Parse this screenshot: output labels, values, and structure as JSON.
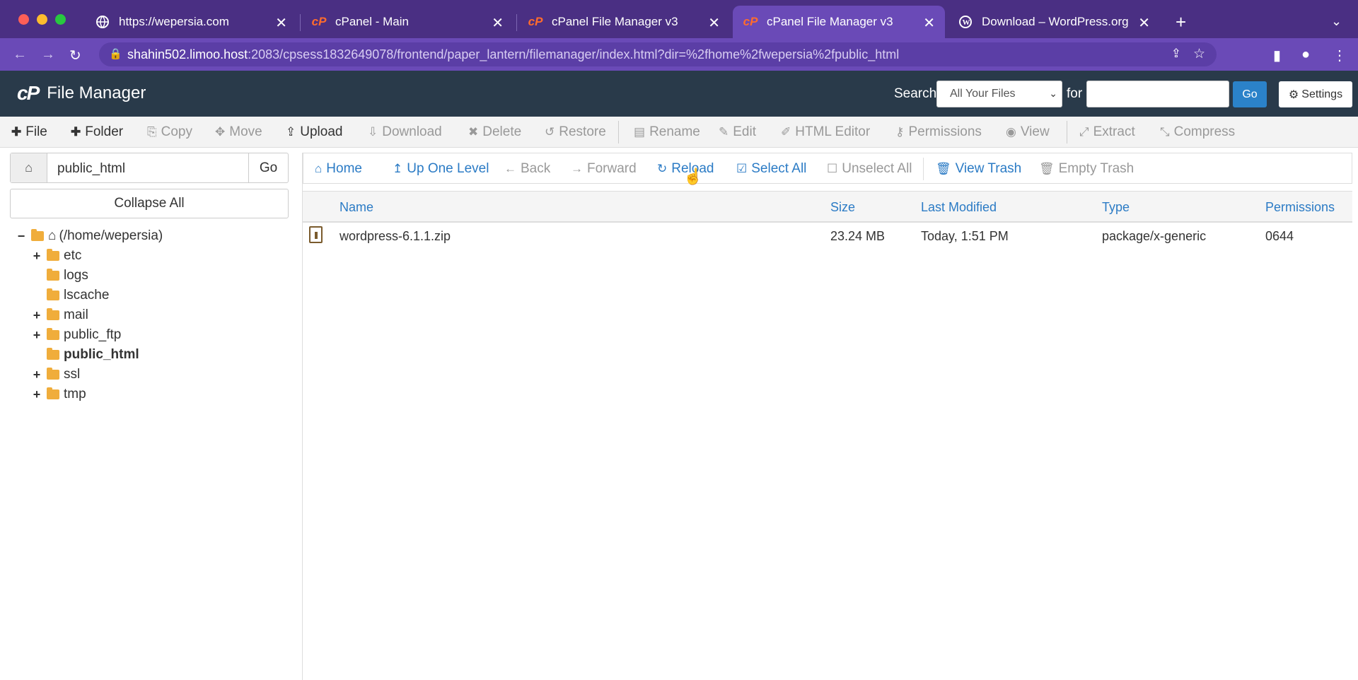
{
  "browser": {
    "tabs": [
      {
        "title": "https://wepersia.com",
        "icon": "globe-icon"
      },
      {
        "title": "cPanel - Main",
        "icon": "cpanel-icon"
      },
      {
        "title": "cPanel File Manager v3",
        "icon": "cpanel-icon"
      },
      {
        "title": "cPanel File Manager v3",
        "icon": "cpanel-icon",
        "active": true
      },
      {
        "title": "Download – WordPress.org",
        "icon": "wordpress-icon"
      }
    ],
    "url_host": "shahin502.limoo.host",
    "url_path": ":2083/cpsess1832649078/frontend/paper_lantern/filemanager/index.html?dir=%2fhome%2fwepersia%2fpublic_html"
  },
  "header": {
    "app_title": "File Manager",
    "search_label": "Search",
    "search_scope": "All Your Files",
    "for_label": "for",
    "search_value": "",
    "go_label": "Go",
    "settings_label": "Settings"
  },
  "toolbar": {
    "file": "File",
    "folder": "Folder",
    "copy": "Copy",
    "move": "Move",
    "upload": "Upload",
    "download": "Download",
    "delete": "Delete",
    "restore": "Restore",
    "rename": "Rename",
    "edit": "Edit",
    "html_editor": "HTML Editor",
    "permissions": "Permissions",
    "view": "View",
    "extract": "Extract",
    "compress": "Compress"
  },
  "sidebar": {
    "path_value": "public_html",
    "go_label": "Go",
    "collapse_label": "Collapse All",
    "tree": [
      {
        "label": "(/home/wepersia)",
        "expander": "−"
      },
      {
        "label": "etc",
        "expander": "+"
      },
      {
        "label": "logs",
        "expander": ""
      },
      {
        "label": "lscache",
        "expander": ""
      },
      {
        "label": "mail",
        "expander": "+"
      },
      {
        "label": "public_ftp",
        "expander": "+"
      },
      {
        "label": "public_html",
        "expander": "",
        "selected": true
      },
      {
        "label": "ssl",
        "expander": "+"
      },
      {
        "label": "tmp",
        "expander": "+"
      }
    ]
  },
  "navbar": {
    "home": "Home",
    "up": "Up One Level",
    "back": "Back",
    "forward": "Forward",
    "reload": "Reload",
    "select_all": "Select All",
    "unselect_all": "Unselect All",
    "view_trash": "View Trash",
    "empty_trash": "Empty Trash"
  },
  "table": {
    "columns": [
      "Name",
      "Size",
      "Last Modified",
      "Type",
      "Permissions"
    ],
    "rows": [
      {
        "name": "wordpress-6.1.1.zip",
        "size": "23.24 MB",
        "modified": "Today, 1:51 PM",
        "type": "package/x-generic",
        "perms": "0644"
      }
    ]
  },
  "colors": {
    "header_bg": "#293a4a",
    "accent": "#2b82c9",
    "link": "#2b7bc5",
    "folder": "#f0ad3b"
  }
}
